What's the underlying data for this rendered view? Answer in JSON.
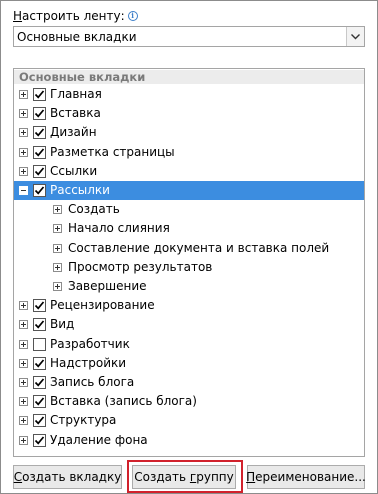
{
  "ribbon": {
    "label_accel": "Н",
    "label_rest": "астроить ленту:",
    "info_icon_glyph": "i",
    "selected": "Основные вкладки"
  },
  "tree": {
    "header": "Основные вкладки",
    "rows": [
      {
        "label": "Главная",
        "level": 0,
        "expander": "plus",
        "checked": true
      },
      {
        "label": "Вставка",
        "level": 0,
        "expander": "plus",
        "checked": true
      },
      {
        "label": "Дизайн",
        "level": 0,
        "expander": "plus",
        "checked": true
      },
      {
        "label": "Разметка страницы",
        "level": 0,
        "expander": "plus",
        "checked": true
      },
      {
        "label": "Ссылки",
        "level": 0,
        "expander": "plus",
        "checked": true
      },
      {
        "label": "Рассылки",
        "level": 0,
        "expander": "minus",
        "checked": true,
        "selected": true
      },
      {
        "label": "Создать",
        "level": 1,
        "expander": "plus"
      },
      {
        "label": "Начало слияния",
        "level": 1,
        "expander": "plus"
      },
      {
        "label": "Составление документа и вставка полей",
        "level": 1,
        "expander": "plus"
      },
      {
        "label": "Просмотр результатов",
        "level": 1,
        "expander": "plus"
      },
      {
        "label": "Завершение",
        "level": 1,
        "expander": "plus"
      },
      {
        "label": "Рецензирование",
        "level": 0,
        "expander": "plus",
        "checked": true
      },
      {
        "label": "Вид",
        "level": 0,
        "expander": "plus",
        "checked": true
      },
      {
        "label": "Разработчик",
        "level": 0,
        "expander": "plus",
        "checked": false
      },
      {
        "label": "Надстройки",
        "level": 0,
        "expander": "plus",
        "checked": true
      },
      {
        "label": "Запись блога",
        "level": 0,
        "expander": "plus",
        "checked": true
      },
      {
        "label": "Вставка (запись блога)",
        "level": 0,
        "expander": "plus",
        "checked": true
      },
      {
        "label": "Структура",
        "level": 0,
        "expander": "plus",
        "checked": true
      },
      {
        "label": "Удаление фона",
        "level": 0,
        "expander": "plus",
        "checked": true
      }
    ]
  },
  "buttons": {
    "new_tab": {
      "accel": "С",
      "rest": "оздать вкладку"
    },
    "new_group": {
      "pre": "Создать ",
      "accel": "г",
      "rest": "руппу"
    },
    "rename": {
      "accel": "П",
      "rest": "ереименование..."
    }
  },
  "colors": {
    "selection": "#3c8de0",
    "highlight_border": "#d1212c"
  }
}
